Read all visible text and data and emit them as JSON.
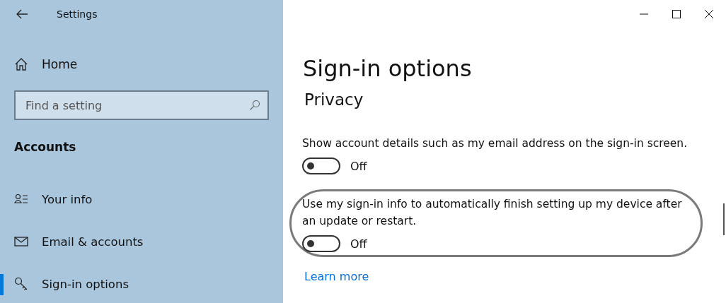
{
  "window": {
    "title": "Settings"
  },
  "sidebar": {
    "home": "Home",
    "search": {
      "placeholder": "Find a setting"
    },
    "section": "Accounts",
    "items": [
      {
        "label": "Your info",
        "kind": "person",
        "selected": false
      },
      {
        "label": "Email & accounts",
        "kind": "mail",
        "selected": false
      },
      {
        "label": "Sign-in options",
        "kind": "key",
        "selected": true
      }
    ]
  },
  "page": {
    "title": "Sign-in options",
    "section": "Privacy",
    "settings": [
      {
        "description": "Show account details such as my email address on the sign-in screen.",
        "on": false,
        "state": "Off",
        "highlighted": false
      },
      {
        "description": "Use my sign-in info to automatically finish setting up my device after an update or restart.",
        "on": false,
        "state": "Off",
        "highlighted": true
      }
    ],
    "link": "Learn more"
  }
}
